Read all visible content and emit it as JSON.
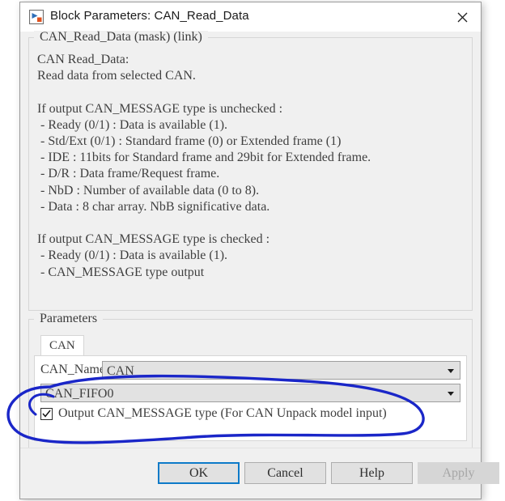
{
  "window": {
    "title": "Block Parameters: CAN_Read_Data",
    "icon": "simulink-block-icon",
    "close_icon": "close-icon"
  },
  "description": {
    "legend": "CAN_Read_Data (mask) (link)",
    "text": "CAN Read_Data:\nRead data from selected CAN.\n\nIf output CAN_MESSAGE type is unchecked :\n - Ready (0/1) : Data is available (1).\n - Std/Ext (0/1) : Standard frame (0) or Extended frame (1)\n - IDE : 11bits for Standard frame and 29bit for Extended frame.\n - D/R : Data frame/Request frame.\n - NbD : Number of available data (0 to 8).\n - Data : 8 char array. NbB significative data.\n\nIf output CAN_MESSAGE type is checked :\n - Ready (0/1) : Data is available (1).\n - CAN_MESSAGE type output"
  },
  "parameters": {
    "legend": "Parameters",
    "tabs": [
      {
        "label": "CAN",
        "selected": true
      }
    ],
    "can_name": {
      "label": "CAN_Name",
      "value": "CAN",
      "arrow_icon": "chevron-down-icon"
    },
    "fifo": {
      "value": "CAN_FIFO0",
      "arrow_icon": "chevron-down-icon"
    },
    "output_message": {
      "label": "Output CAN_MESSAGE type (For CAN Unpack model input)",
      "checked": true,
      "check_icon": "checkmark-icon"
    }
  },
  "buttons": {
    "ok": "OK",
    "cancel": "Cancel",
    "help": "Help",
    "apply": "Apply"
  },
  "colors": {
    "focus_blue": "#0d7ac8",
    "annotation_blue": "#1a26c8",
    "window_bg": "#f0f0f0",
    "field_bg": "#e2e2e2"
  },
  "annotation": {
    "shape": "hand-drawn-ellipse-highlight"
  }
}
